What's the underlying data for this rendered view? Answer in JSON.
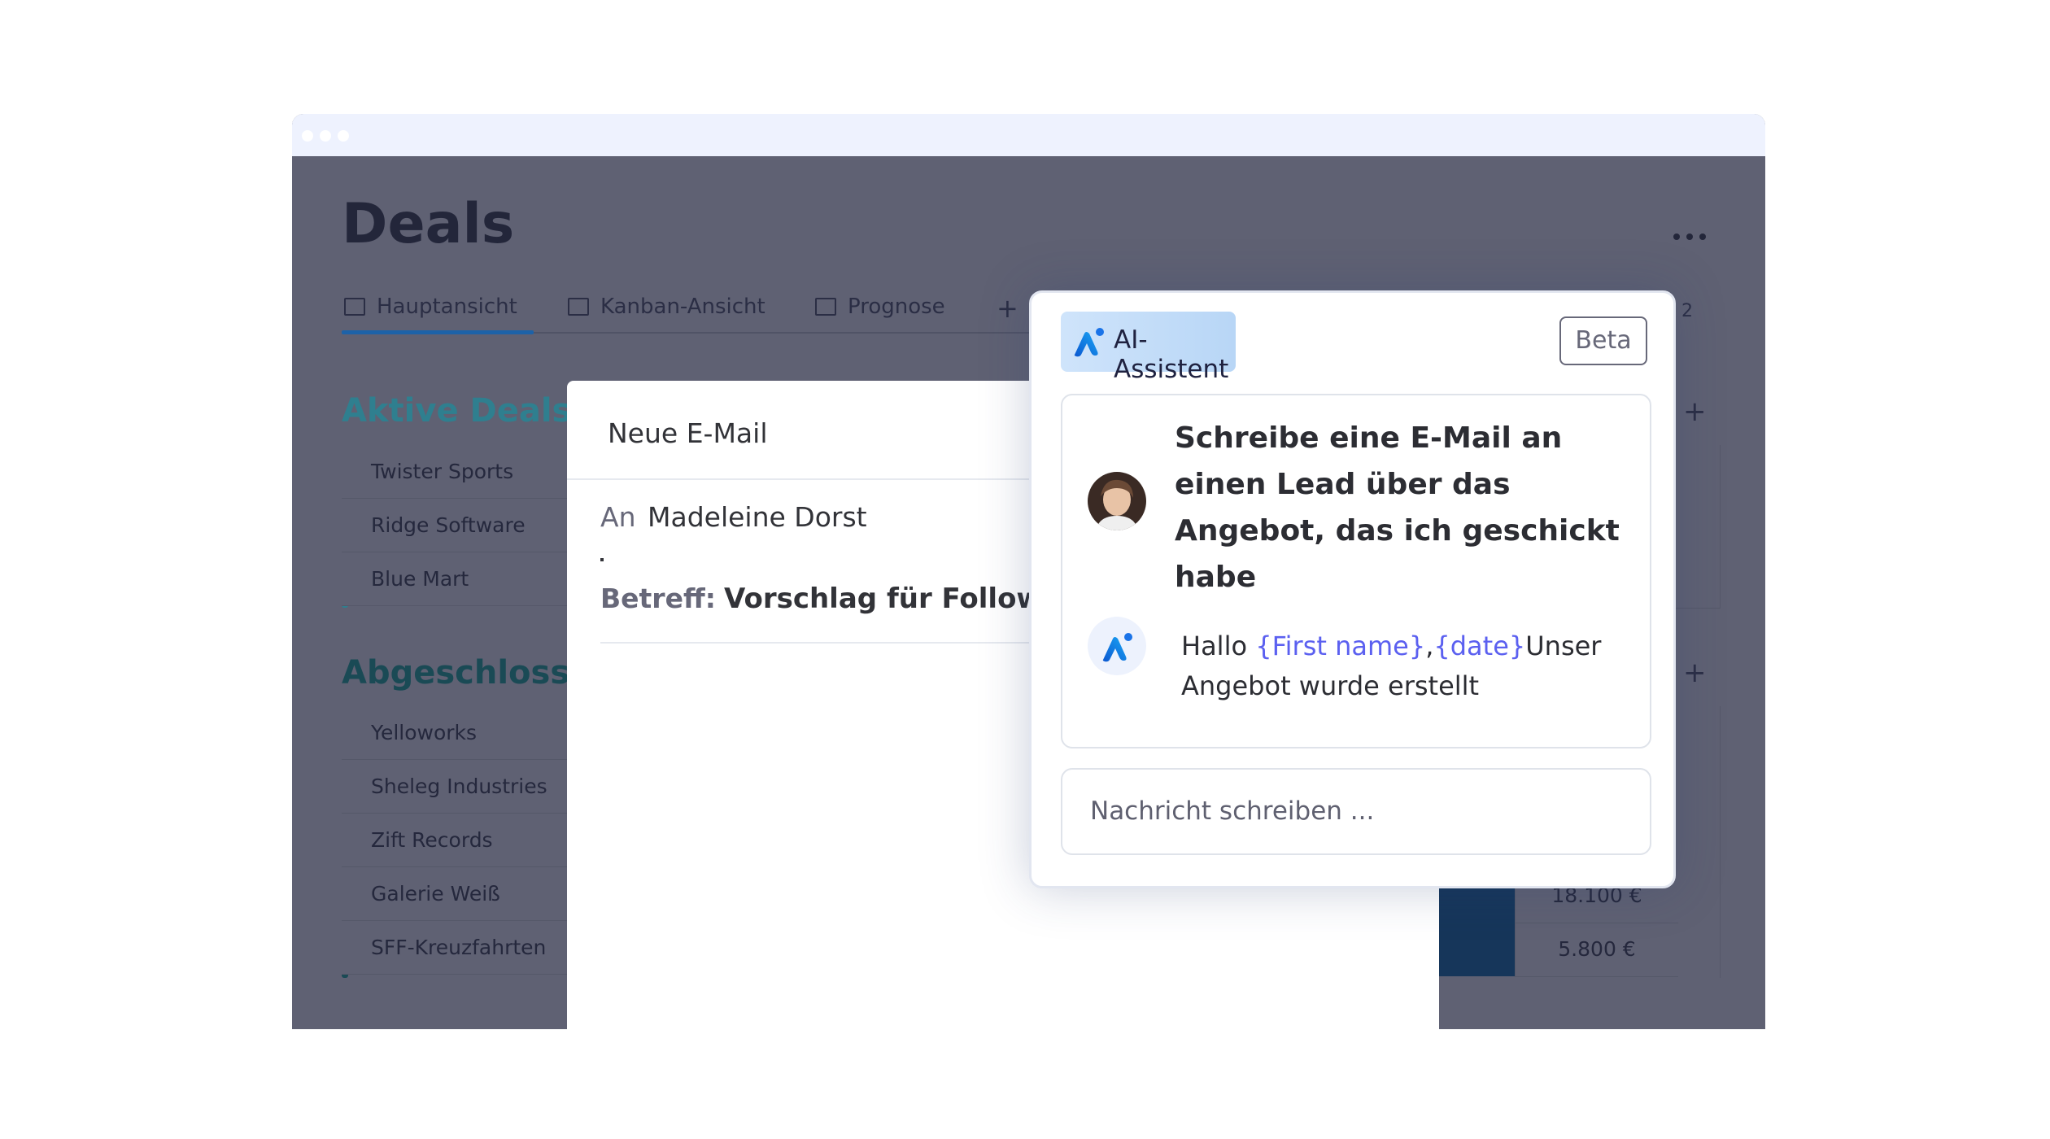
{
  "board": {
    "title": "Deals",
    "tabs": [
      {
        "label": "Hauptansicht",
        "icon": "table-icon"
      },
      {
        "label": "Kanban-Ansicht",
        "icon": "kanban-icon"
      },
      {
        "label": "Prognose",
        "icon": "chart-icon"
      }
    ],
    "add_tab": "+",
    "hidden_count": "2",
    "groups": [
      {
        "title": "Aktive Deals",
        "color": "#2f7f8f",
        "items": [
          "Twister Sports",
          "Ridge Software",
          "Blue Mart"
        ]
      },
      {
        "title": "Abgeschlosse",
        "color": "#1a4a55",
        "items": [
          "Yelloworks",
          "Sheleg Industries",
          "Zift Records",
          "Galerie Weiß",
          "SFF-Kreuzfahrten"
        ]
      }
    ],
    "add_group_item": "+",
    "amounts": [
      "18.100 €",
      "5.800 €"
    ]
  },
  "email": {
    "title": "Neue E-Mail",
    "to_label": "An",
    "to_value": "Madeleine Dorst",
    "subject_label": "Betreff:",
    "subject_value": "Vorschlag für Follow-u"
  },
  "assistant": {
    "title": "AI-Assistent",
    "badge": "Beta",
    "prompt": "Schreibe eine E-Mail an einen Lead über das Angebot, das ich geschickt habe",
    "reply": {
      "prefix": "Hallo ",
      "var1": "{First name}",
      "sep": ",",
      "var2": "{date}",
      "text": "Unser Angebot wurde erstellt"
    },
    "input_placeholder": "Nachricht schreiben ..."
  },
  "colors": {
    "overlay": "#5f6173",
    "accent_blue": "#1d62a8",
    "variable": "#5b60f0",
    "status_dark": "#16365a"
  }
}
